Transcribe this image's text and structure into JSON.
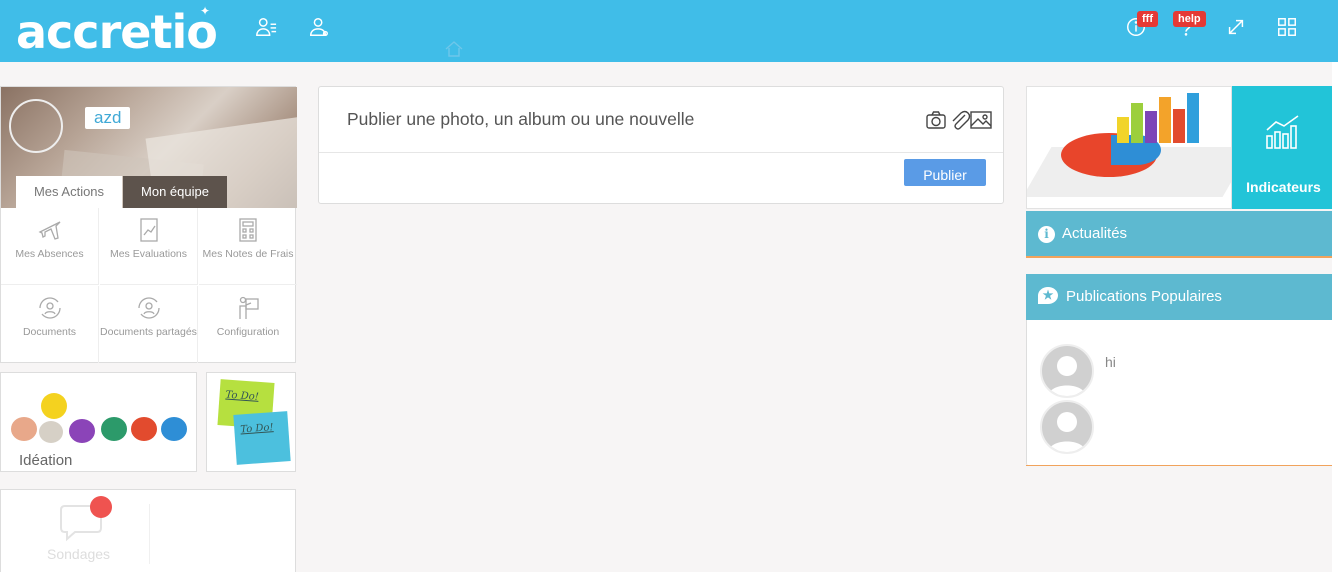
{
  "app": {
    "logo_text": "accretio"
  },
  "topbar": {
    "badges": {
      "info": "fff",
      "help": "help"
    },
    "icons": [
      "users-list-icon",
      "user-icon",
      "home-icon",
      "info-icon",
      "help-icon",
      "expand-icon",
      "apps-grid-icon"
    ]
  },
  "profile": {
    "username": "azd",
    "tabs": [
      {
        "label": "Mes Actions",
        "active": true
      },
      {
        "label": "Mon équipe",
        "active": false
      }
    ],
    "actions": [
      {
        "label": "Mes Absences",
        "icon": "airplane-icon"
      },
      {
        "label": "Mes Evaluations",
        "icon": "chart-document-icon"
      },
      {
        "label": "Mes Notes de Frais",
        "icon": "calculator-icon"
      },
      {
        "label": "Documents",
        "icon": "refresh-user-icon"
      },
      {
        "label": "Documents partagés",
        "icon": "refresh-user-icon"
      },
      {
        "label": "Configuration",
        "icon": "presentation-icon"
      }
    ]
  },
  "tiles": {
    "ideation_label": "Idéation",
    "todo_notes": [
      "To Do!",
      "To Do!"
    ],
    "sondages_label": "Sondages"
  },
  "composer": {
    "placeholder": "Publier une photo, un album ou une nouvelle",
    "publish_label": "Publier",
    "icons": [
      "camera-icon",
      "paperclip-icon",
      "image-icon"
    ]
  },
  "right": {
    "indicateurs_label": "Indicateurs",
    "actualites_label": "Actualités",
    "populaires_label": "Publications Populaires",
    "popular_posts": [
      {
        "text": "hi"
      },
      {
        "text": ""
      }
    ]
  },
  "colors": {
    "topbar": "#40bde8",
    "indicateurs": "#22c4d8",
    "widget_header": "#5db9d0",
    "widget_accent": "#f1a35c",
    "publish_button": "#5a9be6",
    "badge": "#e53935"
  }
}
